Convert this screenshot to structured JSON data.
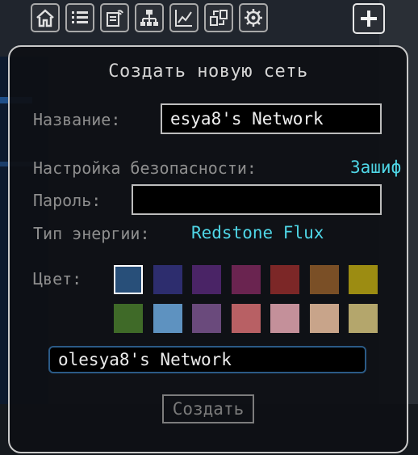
{
  "toolbar": {
    "tools": [
      {
        "icon": "home-icon"
      },
      {
        "icon": "list-icon"
      },
      {
        "icon": "wireless-device-icon"
      },
      {
        "icon": "network-tree-icon"
      },
      {
        "icon": "chart-icon"
      },
      {
        "icon": "transfer-icon"
      },
      {
        "icon": "gear-icon"
      }
    ],
    "add_icon": "plus-icon"
  },
  "dialog": {
    "title": "Создать новую сеть",
    "name_label": "Название:",
    "name_value": "esya8's Network",
    "security_label": "Настройка безопасности:",
    "security_value": "Зашиф",
    "password_label": "Пароль:",
    "password_value": "",
    "energy_label": "Тип энергии:",
    "energy_value": "Redstone Flux",
    "color_label": "Цвет:",
    "colors_row1": [
      "#284f79",
      "#2d2d6e",
      "#4a2466",
      "#6a2450",
      "#7c2727",
      "#7a4f26",
      "#9c8c12"
    ],
    "colors_row2": [
      "#3f6a28",
      "#5e92c0",
      "#6a4a7c",
      "#b86064",
      "#c4909a",
      "#c8a48a",
      "#b4a66c"
    ],
    "selected_color_index": 0,
    "preview_name": "olesya8's Network",
    "create_button": "Создать"
  },
  "colors": {
    "accent_cyan": "#4fd6e6",
    "panel_border": "#c9c9c9"
  }
}
